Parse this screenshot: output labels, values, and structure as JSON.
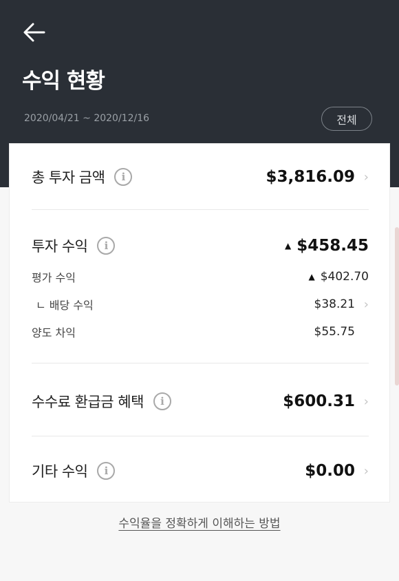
{
  "header": {
    "title": "수익 현황",
    "date_range": "2020/04/21 ~ 2020/12/16",
    "period_button": "전체"
  },
  "rows": {
    "total_investment": {
      "label": "총 투자 금액",
      "amount": "$3,816.09"
    },
    "investment_profit": {
      "label": "투자 수익",
      "amount": "$458.45"
    },
    "valuation_profit": {
      "label": "평가 수익",
      "amount": "$402.70"
    },
    "dividend_profit": {
      "label": "ㄴ 배당 수익",
      "amount": "$38.21"
    },
    "transfer_gain": {
      "label": "양도 차익",
      "amount": "$55.75"
    },
    "fee_refund": {
      "label": "수수료 환급금 혜택",
      "amount": "$600.31"
    },
    "other_profit": {
      "label": "기타 수익",
      "amount": "$0.00"
    }
  },
  "footer": {
    "link_text": "수익율을 정확하게 이해하는 방법"
  },
  "icons": {
    "back": "arrow-left-icon",
    "info": "info-circle-icon",
    "chevron": "chevron-right-icon",
    "up": "triangle-up-icon"
  },
  "colors": {
    "header_bg": "#2a2f36",
    "card_bg": "#ffffff",
    "page_bg": "#f7f7f7"
  }
}
